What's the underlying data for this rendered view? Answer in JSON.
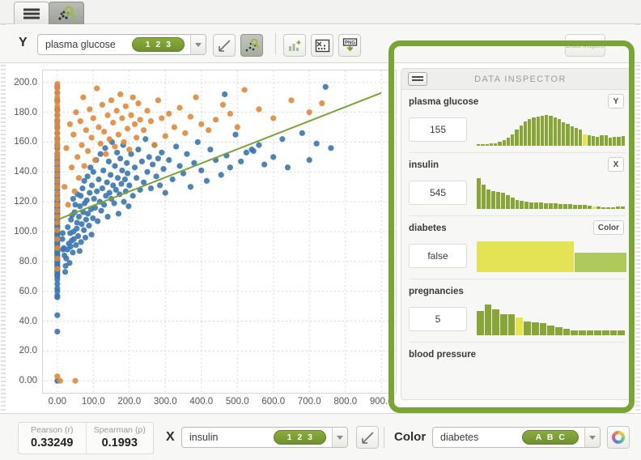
{
  "window": {
    "tabs": [
      {
        "name": "data-table-tab",
        "icon": "list-icon",
        "active": false
      },
      {
        "name": "scatter-explore-tab",
        "icon": "scatter-magnifier-icon",
        "active": true
      }
    ]
  },
  "toolbar": {
    "y_label": "Y",
    "y_field": "plasma glucose",
    "y_badge": "1 2 3",
    "buttons": [
      {
        "name": "line-chart-button",
        "icon": "line-chart-icon",
        "pressed": false
      },
      {
        "name": "scatter-plot-button",
        "icon": "scatter-icon",
        "pressed": true
      },
      {
        "name": "add-chart-button",
        "icon": "bar-chart-plus-icon",
        "pressed": false
      },
      {
        "name": "shuffle-matrix-button",
        "icon": "shuffle-matrix-icon",
        "pressed": false
      },
      {
        "name": "export-png-button",
        "icon": "png-download-icon",
        "pressed": false
      }
    ],
    "data_inspector_toggle": "Data inspector"
  },
  "statusbar": {
    "correlations": [
      {
        "label": "Pearson (r)",
        "value": "0.33249"
      },
      {
        "label": "Spearman (ρ)",
        "value": "0.1993"
      }
    ],
    "x_label": "X",
    "x_field": "insulin",
    "x_badge": "1 2 3",
    "regression_button": "regression-line-icon",
    "color_label": "Color",
    "color_field": "diabetes",
    "color_badge": "A B C",
    "palette_button": "color-wheel-icon"
  },
  "inspector": {
    "title": "DATA INSPECTOR",
    "menu_icon": "list-icon",
    "fields": [
      {
        "name": "plasma glucose",
        "value": "155",
        "role": "Y",
        "type": "histogram",
        "bars": [
          4,
          5,
          6,
          7,
          9,
          13,
          19,
          27,
          38,
          52,
          66,
          78,
          86,
          92,
          95,
          97,
          100,
          98,
          93,
          86,
          77,
          70,
          64,
          58,
          53,
          36,
          34,
          32,
          30,
          35,
          33,
          26,
          28,
          30,
          31
        ],
        "highlight_index": 25
      },
      {
        "name": "insulin",
        "value": "545",
        "role": "X",
        "type": "histogram",
        "bars": [
          100,
          78,
          62,
          57,
          55,
          52,
          44,
          38,
          30,
          26,
          24,
          22,
          21,
          20,
          19,
          18,
          18,
          17,
          16,
          15,
          14,
          13,
          12,
          11,
          9,
          8,
          4,
          3,
          2,
          8,
          9
        ],
        "highlight_index": 24
      },
      {
        "name": "diabetes",
        "value": "false",
        "role": "Color",
        "type": "categorical",
        "categories": [
          {
            "label": "false",
            "share": 0.65,
            "height": 1.0,
            "color": "#e4e356"
          },
          {
            "label": "true",
            "share": 0.35,
            "height": 0.62,
            "color": "#b0c95c"
          }
        ]
      },
      {
        "name": "pregnancies",
        "value": "5",
        "role": "",
        "type": "histogram",
        "bars": [
          78,
          98,
          82,
          68,
          66,
          56,
          44,
          42,
          38,
          30,
          27,
          20,
          16,
          15,
          15,
          15,
          15,
          15,
          15
        ],
        "highlight_index": 5
      },
      {
        "name": "blood pressure",
        "value": "",
        "role": "",
        "type": "histogram",
        "bars": [],
        "highlight_index": -1
      }
    ]
  },
  "chart_data": {
    "type": "scatter",
    "title": "",
    "xlabel": "insulin",
    "ylabel": "plasma glucose",
    "xlim": [
      -40,
      940
    ],
    "ylim": [
      -8,
      208
    ],
    "x_ticks": [
      "0.00",
      "100.0",
      "200.0",
      "300.0",
      "400.0",
      "500.0",
      "600.0",
      "700.0",
      "800.0",
      "900.0"
    ],
    "y_ticks": [
      "0.00",
      "20.0",
      "40.0",
      "60.0",
      "80.0",
      "100.0",
      "120.0",
      "140.0",
      "160.0",
      "180.0",
      "200.0"
    ],
    "grid": true,
    "legend": "none",
    "series": [
      {
        "name": "false",
        "color": "#3b76af",
        "marker": "circle"
      },
      {
        "name": "true",
        "color": "#e08a3c",
        "marker": "circle"
      }
    ],
    "trendline": {
      "name": "linear-regression",
      "color": "#7ba437",
      "x0": 0,
      "y0": 108,
      "x1": 900,
      "y1": 193
    },
    "points_false": [
      [
        0,
        33
      ],
      [
        0,
        44
      ],
      [
        0,
        56
      ],
      [
        0,
        57
      ],
      [
        0,
        60
      ],
      [
        0,
        62
      ],
      [
        0,
        65
      ],
      [
        0,
        68
      ],
      [
        0,
        70
      ],
      [
        0,
        71
      ],
      [
        0,
        72
      ],
      [
        0,
        73
      ],
      [
        0,
        74
      ],
      [
        0,
        75
      ],
      [
        0,
        76
      ],
      [
        0,
        77
      ],
      [
        0,
        78
      ],
      [
        0,
        79
      ],
      [
        0,
        80
      ],
      [
        0,
        81
      ],
      [
        0,
        82
      ],
      [
        0,
        83
      ],
      [
        0,
        84
      ],
      [
        0,
        85
      ],
      [
        0,
        86
      ],
      [
        0,
        87
      ],
      [
        0,
        88
      ],
      [
        0,
        89
      ],
      [
        0,
        90
      ],
      [
        0,
        91
      ],
      [
        0,
        92
      ],
      [
        0,
        93
      ],
      [
        0,
        94
      ],
      [
        0,
        95
      ],
      [
        0,
        96
      ],
      [
        0,
        97
      ],
      [
        0,
        98
      ],
      [
        0,
        99
      ],
      [
        0,
        100
      ],
      [
        0,
        101
      ],
      [
        0,
        102
      ],
      [
        0,
        103
      ],
      [
        0,
        104
      ],
      [
        0,
        105
      ],
      [
        0,
        106
      ],
      [
        0,
        107
      ],
      [
        0,
        108
      ],
      [
        0,
        109
      ],
      [
        0,
        110
      ],
      [
        0,
        111
      ],
      [
        0,
        112
      ],
      [
        0,
        113
      ],
      [
        0,
        114
      ],
      [
        0,
        115
      ],
      [
        0,
        116
      ],
      [
        0,
        117
      ],
      [
        0,
        118
      ],
      [
        0,
        119
      ],
      [
        0,
        120
      ],
      [
        0,
        121
      ],
      [
        0,
        122
      ],
      [
        0,
        124
      ],
      [
        0,
        126
      ],
      [
        0,
        128
      ],
      [
        0,
        130
      ],
      [
        0,
        132
      ],
      [
        0,
        134
      ],
      [
        0,
        136
      ],
      [
        0,
        138
      ],
      [
        0,
        140
      ],
      [
        0,
        142
      ],
      [
        0,
        144
      ],
      [
        0,
        146
      ],
      [
        0,
        148
      ],
      [
        0,
        150
      ],
      [
        0,
        152
      ],
      [
        0,
        156
      ],
      [
        0,
        158
      ],
      [
        0,
        162
      ],
      [
        0,
        166
      ],
      [
        0,
        170
      ],
      [
        0,
        174
      ],
      [
        0,
        178
      ],
      [
        0,
        182
      ],
      [
        0,
        188
      ],
      [
        0,
        193
      ],
      [
        0,
        197
      ],
      [
        0,
        0
      ],
      [
        14,
        95
      ],
      [
        15,
        99
      ],
      [
        16,
        88
      ],
      [
        18,
        89
      ],
      [
        20,
        84
      ],
      [
        22,
        73
      ],
      [
        23,
        77
      ],
      [
        25,
        82
      ],
      [
        28,
        88
      ],
      [
        29,
        103
      ],
      [
        32,
        92
      ],
      [
        34,
        79
      ],
      [
        36,
        99
      ],
      [
        37,
        90
      ],
      [
        38,
        108
      ],
      [
        40,
        94
      ],
      [
        41,
        111
      ],
      [
        43,
        86
      ],
      [
        44,
        122
      ],
      [
        45,
        100
      ],
      [
        46,
        95
      ],
      [
        48,
        113
      ],
      [
        50,
        118
      ],
      [
        52,
        91
      ],
      [
        54,
        102
      ],
      [
        55,
        106
      ],
      [
        56,
        125
      ],
      [
        58,
        97
      ],
      [
        60,
        110
      ],
      [
        62,
        87
      ],
      [
        63,
        117
      ],
      [
        65,
        124
      ],
      [
        66,
        93
      ],
      [
        68,
        105
      ],
      [
        70,
        129
      ],
      [
        72,
        113
      ],
      [
        74,
        101
      ],
      [
        75,
        134
      ],
      [
        76,
        119
      ],
      [
        78,
        96
      ],
      [
        80,
        108
      ],
      [
        82,
        121
      ],
      [
        84,
        137
      ],
      [
        85,
        112
      ],
      [
        88,
        104
      ],
      [
        90,
        126
      ],
      [
        92,
        143
      ],
      [
        94,
        115
      ],
      [
        95,
        98
      ],
      [
        96,
        131
      ],
      [
        99,
        109
      ],
      [
        100,
        140
      ],
      [
        102,
        122
      ],
      [
        105,
        116
      ],
      [
        108,
        148
      ],
      [
        110,
        127
      ],
      [
        112,
        107
      ],
      [
        115,
        135
      ],
      [
        118,
        120
      ],
      [
        120,
        152
      ],
      [
        122,
        114
      ],
      [
        125,
        129
      ],
      [
        128,
        141
      ],
      [
        130,
        118
      ],
      [
        133,
        156
      ],
      [
        135,
        124
      ],
      [
        138,
        133
      ],
      [
        140,
        110
      ],
      [
        143,
        147
      ],
      [
        145,
        126
      ],
      [
        148,
        138
      ],
      [
        150,
        122
      ],
      [
        152,
        160
      ],
      [
        155,
        131
      ],
      [
        158,
        119
      ],
      [
        160,
        144
      ],
      [
        163,
        128
      ],
      [
        166,
        153
      ],
      [
        168,
        136
      ],
      [
        170,
        112
      ],
      [
        173,
        125
      ],
      [
        175,
        149
      ],
      [
        178,
        132
      ],
      [
        180,
        141
      ],
      [
        183,
        158
      ],
      [
        185,
        120
      ],
      [
        188,
        135
      ],
      [
        190,
        127
      ],
      [
        193,
        146
      ],
      [
        195,
        139
      ],
      [
        198,
        117
      ],
      [
        200,
        131
      ],
      [
        205,
        152
      ],
      [
        210,
        124
      ],
      [
        215,
        143
      ],
      [
        220,
        136
      ],
      [
        225,
        155
      ],
      [
        230,
        128
      ],
      [
        235,
        147
      ],
      [
        240,
        133
      ],
      [
        245,
        162
      ],
      [
        250,
        140
      ],
      [
        255,
        150
      ],
      [
        260,
        129
      ],
      [
        265,
        145
      ],
      [
        270,
        158
      ],
      [
        275,
        137
      ],
      [
        280,
        149
      ],
      [
        285,
        131
      ],
      [
        290,
        153
      ],
      [
        295,
        142
      ],
      [
        300,
        126
      ],
      [
        310,
        148
      ],
      [
        320,
        135
      ],
      [
        330,
        157
      ],
      [
        340,
        144
      ],
      [
        350,
        139
      ],
      [
        360,
        152
      ],
      [
        370,
        130
      ],
      [
        380,
        146
      ],
      [
        390,
        160
      ],
      [
        400,
        141
      ],
      [
        415,
        134
      ],
      [
        425,
        155
      ],
      [
        440,
        148
      ],
      [
        455,
        138
      ],
      [
        465,
        192
      ],
      [
        470,
        151
      ],
      [
        480,
        143
      ],
      [
        495,
        165
      ],
      [
        510,
        147
      ],
      [
        525,
        153
      ],
      [
        540,
        155
      ],
      [
        545,
        154
      ],
      [
        560,
        158
      ],
      [
        575,
        145
      ],
      [
        600,
        150
      ],
      [
        625,
        162
      ],
      [
        640,
        143
      ],
      [
        680,
        166
      ],
      [
        700,
        148
      ],
      [
        720,
        159
      ],
      [
        745,
        197
      ],
      [
        760,
        156
      ]
    ],
    "points_true": [
      [
        0,
        75
      ],
      [
        0,
        82
      ],
      [
        0,
        89
      ],
      [
        0,
        95
      ],
      [
        0,
        101
      ],
      [
        0,
        106
      ],
      [
        0,
        110
      ],
      [
        0,
        114
      ],
      [
        0,
        118
      ],
      [
        0,
        122
      ],
      [
        0,
        126
      ],
      [
        0,
        130
      ],
      [
        0,
        134
      ],
      [
        0,
        138
      ],
      [
        0,
        142
      ],
      [
        0,
        146
      ],
      [
        0,
        150
      ],
      [
        0,
        153
      ],
      [
        0,
        157
      ],
      [
        0,
        160
      ],
      [
        0,
        163
      ],
      [
        0,
        166
      ],
      [
        0,
        169
      ],
      [
        0,
        172
      ],
      [
        0,
        175
      ],
      [
        0,
        178
      ],
      [
        0,
        181
      ],
      [
        0,
        184
      ],
      [
        0,
        187
      ],
      [
        0,
        190
      ],
      [
        0,
        193
      ],
      [
        0,
        196
      ],
      [
        0,
        199
      ],
      [
        0,
        3
      ],
      [
        20,
        130
      ],
      [
        25,
        156
      ],
      [
        30,
        118
      ],
      [
        35,
        172
      ],
      [
        40,
        143
      ],
      [
        45,
        165
      ],
      [
        48,
        127
      ],
      [
        52,
        180
      ],
      [
        56,
        150
      ],
      [
        60,
        136
      ],
      [
        64,
        174
      ],
      [
        68,
        158
      ],
      [
        72,
        190
      ],
      [
        75,
        144
      ],
      [
        80,
        168
      ],
      [
        85,
        154
      ],
      [
        90,
        182
      ],
      [
        95,
        163
      ],
      [
        100,
        176
      ],
      [
        105,
        148
      ],
      [
        110,
        196
      ],
      [
        115,
        170
      ],
      [
        120,
        159
      ],
      [
        125,
        185
      ],
      [
        130,
        167
      ],
      [
        135,
        152
      ],
      [
        140,
        178
      ],
      [
        145,
        162
      ],
      [
        150,
        188
      ],
      [
        155,
        173
      ],
      [
        160,
        157
      ],
      [
        165,
        181
      ],
      [
        170,
        165
      ],
      [
        175,
        192
      ],
      [
        180,
        176
      ],
      [
        185,
        160
      ],
      [
        190,
        184
      ],
      [
        195,
        169
      ],
      [
        200,
        155
      ],
      [
        205,
        178
      ],
      [
        210,
        190
      ],
      [
        215,
        172
      ],
      [
        220,
        163
      ],
      [
        225,
        186
      ],
      [
        230,
        175
      ],
      [
        240,
        168
      ],
      [
        250,
        181
      ],
      [
        260,
        174
      ],
      [
        270,
        158
      ],
      [
        280,
        188
      ],
      [
        290,
        176
      ],
      [
        300,
        164
      ],
      [
        310,
        179
      ],
      [
        325,
        170
      ],
      [
        340,
        183
      ],
      [
        355,
        166
      ],
      [
        370,
        177
      ],
      [
        385,
        190
      ],
      [
        400,
        172
      ],
      [
        420,
        168
      ],
      [
        440,
        175
      ],
      [
        460,
        185
      ],
      [
        480,
        179
      ],
      [
        500,
        170
      ],
      [
        520,
        195
      ],
      [
        560,
        182
      ],
      [
        600,
        176
      ],
      [
        650,
        188
      ],
      [
        700,
        180
      ],
      [
        735,
        186
      ],
      [
        50,
        0
      ],
      [
        8,
        0
      ]
    ]
  }
}
